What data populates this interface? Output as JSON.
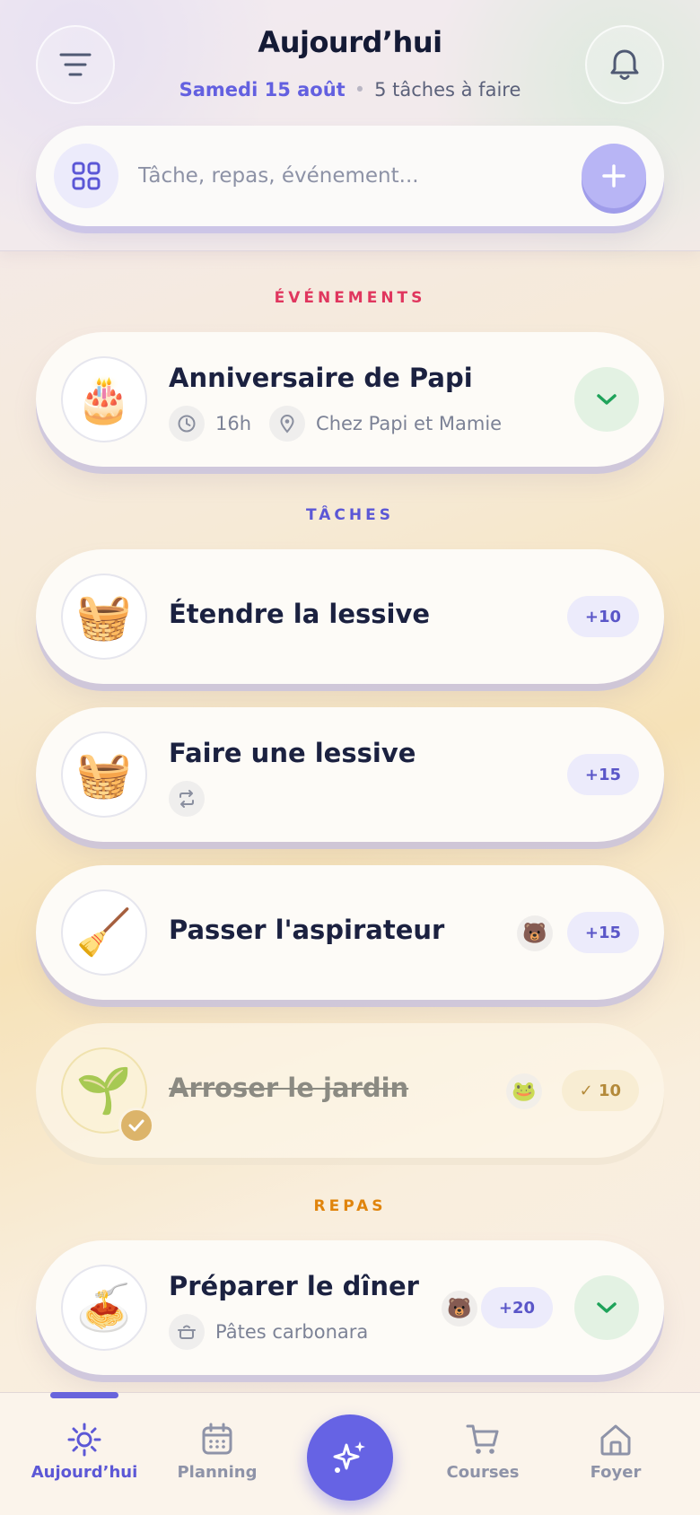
{
  "header": {
    "title": "Aujourd’hui",
    "date": "Samedi 15 août",
    "separator": "•",
    "task_count": "5 tâches à faire"
  },
  "quick_add": {
    "placeholder": "Tâche, repas, événement..."
  },
  "sections": {
    "events": "ÉVÉNEMENTS",
    "tasks": "TÂCHES",
    "meals": "REPAS"
  },
  "events": [
    {
      "emoji": "🎂",
      "title": "Anniversaire de Papi",
      "time": "16h",
      "location": "Chez Papi et Mamie"
    }
  ],
  "tasks": [
    {
      "emoji": "🧺",
      "title": "Étendre la lessive",
      "points": "+10"
    },
    {
      "emoji": "🧺",
      "title": "Faire une lessive",
      "points": "+15",
      "recurring": true
    },
    {
      "emoji": "🧹",
      "title": "Passer l'aspirateur",
      "points": "+15",
      "assignee": "🐻"
    },
    {
      "emoji": "🌱",
      "title": "Arroser le jardin",
      "points": "✓ 10",
      "assignee": "🐸",
      "done": true
    }
  ],
  "meals": [
    {
      "emoji": "🍝",
      "title": "Préparer le dîner",
      "recipe": "Pâtes carbonara",
      "points": "+20",
      "assignee": "🐻"
    }
  ],
  "nav": {
    "today": "Aujourd’hui",
    "planning": "Planning",
    "shopping": "Courses",
    "home": "Foyer"
  },
  "colors": {
    "accent": "#6663e4",
    "events_section": "#e0365e",
    "tasks_section": "#5b57d6",
    "meals_section": "#e0840c",
    "success": "#1fa35a"
  }
}
